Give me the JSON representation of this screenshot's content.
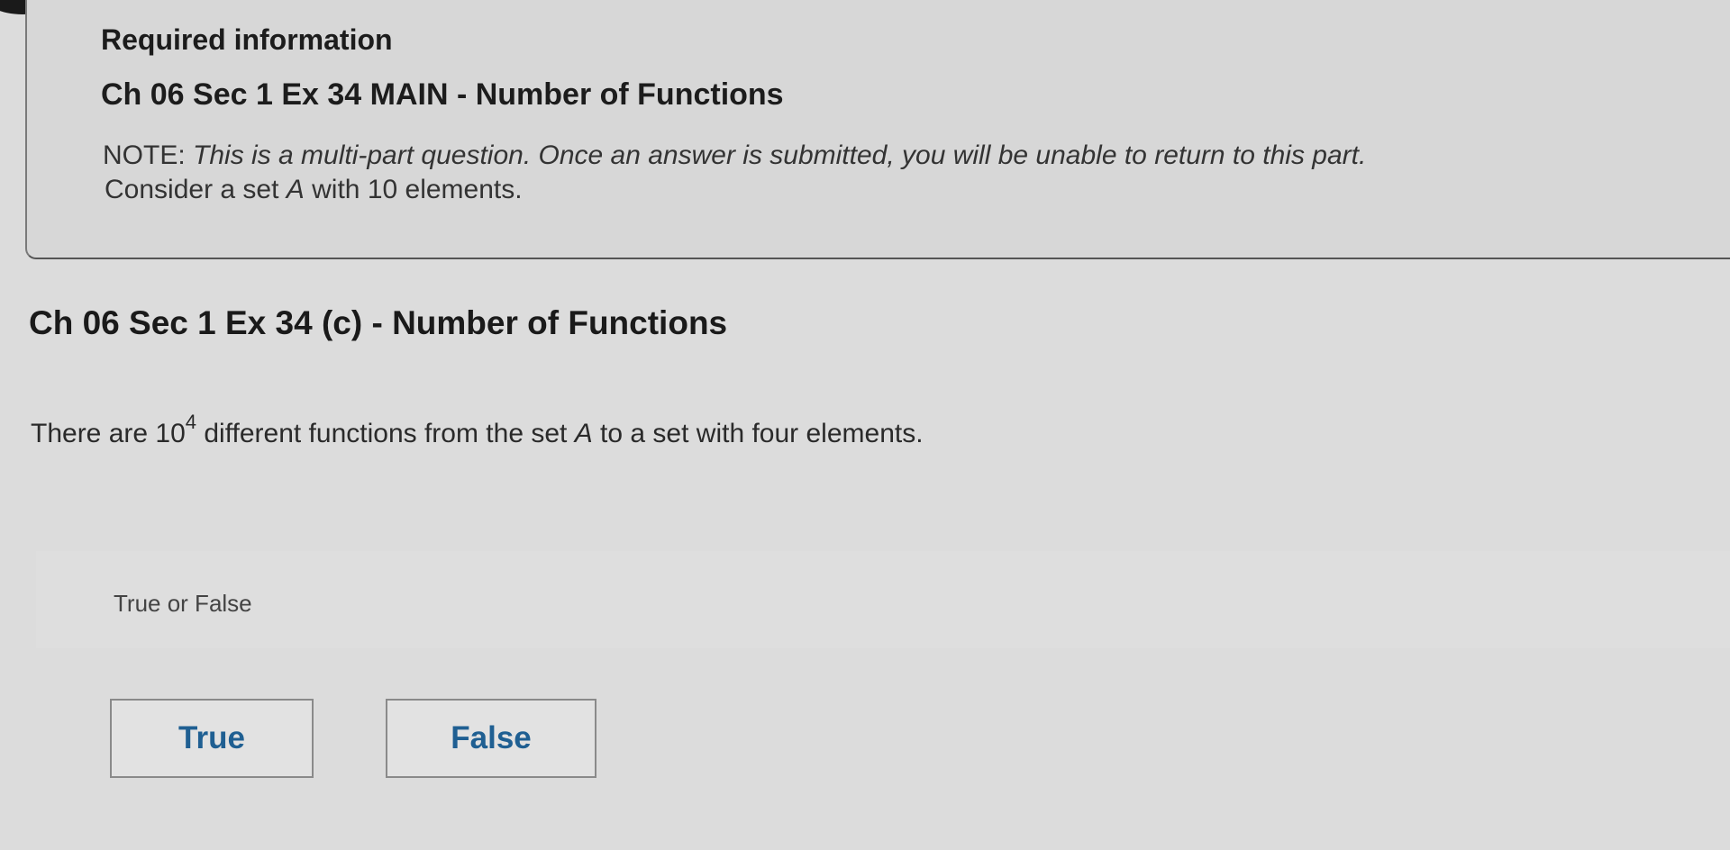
{
  "required": {
    "heading": "Required information",
    "title": "Ch 06 Sec 1 Ex 34 MAIN - Number of Functions",
    "note_label": "NOTE:",
    "note_text": "This is a multi-part question. Once an answer is submitted, you will be unable to return to this part.",
    "consider_pre": "Consider a set ",
    "consider_var": "A",
    "consider_post": " with 10 elements."
  },
  "question": {
    "title": "Ch 06 Sec 1 Ex 34 (c) - Number of Functions",
    "statement_pre": "There are 10",
    "statement_exp": "4",
    "statement_mid": " different functions from the set ",
    "statement_var": "A",
    "statement_post": " to a set with four elements."
  },
  "answer": {
    "prompt": "True or False",
    "true_label": "True",
    "false_label": "False"
  },
  "colors": {
    "button_text": "#1f5f92"
  }
}
